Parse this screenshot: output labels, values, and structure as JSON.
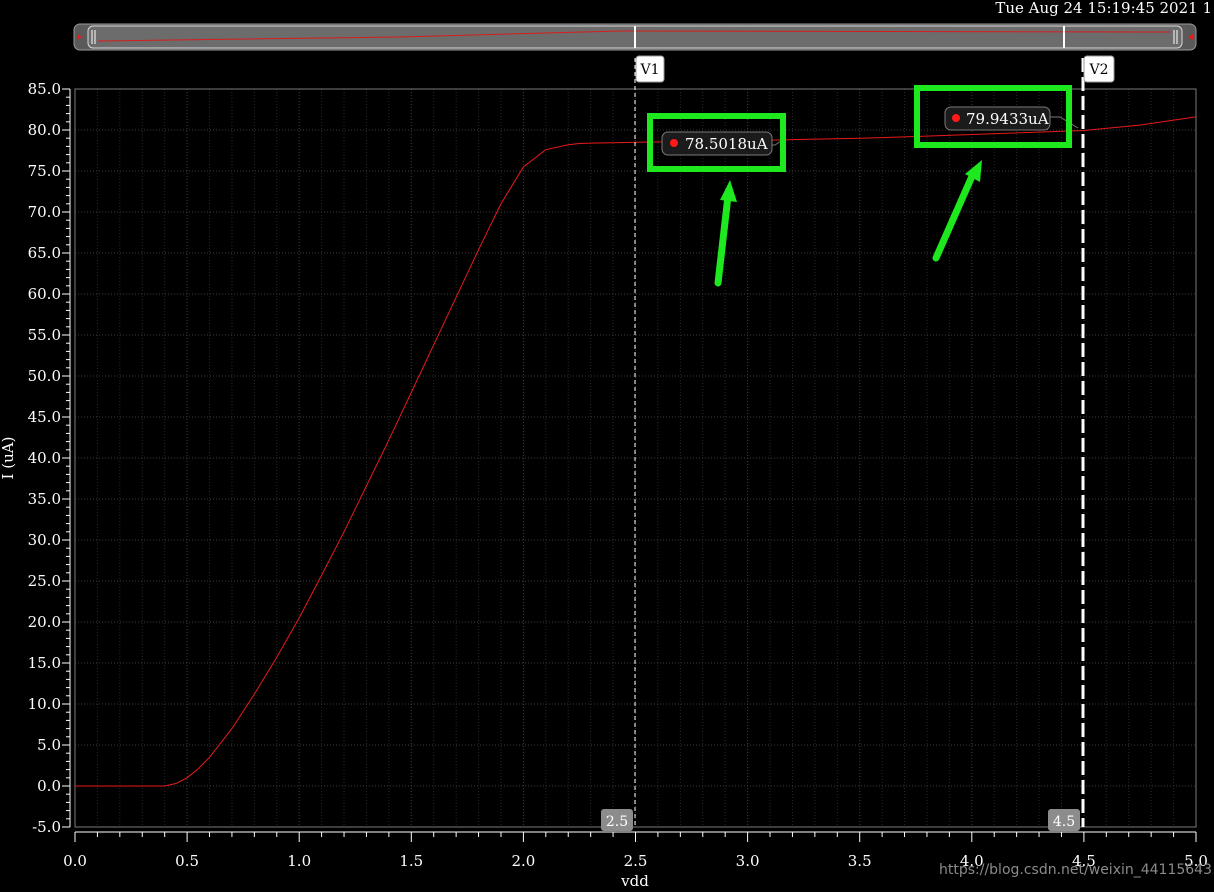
{
  "header": {
    "timestamp": "Tue Aug 24 15:19:45 2021  1"
  },
  "watermark": "https://blog.csdn.net/weixin_44115643",
  "markers": {
    "v1": {
      "label": "V1",
      "x": 2.5,
      "readout": "2.5",
      "point_label": "78.5018uA",
      "y": 78.5018
    },
    "v2": {
      "label": "V2",
      "x": 4.5,
      "readout": "4.5",
      "point_label": "79.9433uA",
      "y": 79.9433
    }
  },
  "colors": {
    "background": "#000000",
    "grid": "#3a3a3a",
    "trace": "#e8191c",
    "axis": "#ffffff",
    "highlight": "#1ee81e",
    "label_bg": "#2b2b2b"
  },
  "chart_data": {
    "type": "line",
    "title": "",
    "xlabel": "vdd",
    "ylabel": "I (uA)",
    "xlim": [
      0.0,
      5.0
    ],
    "ylim": [
      -5.0,
      85.0
    ],
    "grid": true,
    "x_ticks": [
      "0.0",
      "0.5",
      "1.0",
      "1.5",
      "2.0",
      "2.5",
      "3.0",
      "3.5",
      "4.0",
      "4.5",
      "5.0"
    ],
    "y_ticks": [
      "85.0",
      "80.0",
      "75.0",
      "70.0",
      "65.0",
      "60.0",
      "55.0",
      "50.0",
      "45.0",
      "40.0",
      "35.0",
      "30.0",
      "25.0",
      "20.0",
      "15.0",
      "10.0",
      "5.0",
      "0.0",
      "-5.0"
    ],
    "series": [
      {
        "name": "",
        "x": [
          0.0,
          0.4,
          0.45,
          0.5,
          0.55,
          0.6,
          0.7,
          0.8,
          0.9,
          1.0,
          1.1,
          1.2,
          1.3,
          1.4,
          1.5,
          1.6,
          1.7,
          1.8,
          1.9,
          2.0,
          2.1,
          2.2,
          2.25,
          2.3,
          2.4,
          2.5,
          2.75,
          3.0,
          3.25,
          3.5,
          3.75,
          4.0,
          4.25,
          4.5,
          4.75,
          5.0
        ],
        "y": [
          0.0,
          0.0,
          0.3,
          1.0,
          2.1,
          3.5,
          7.0,
          11.2,
          15.7,
          20.5,
          25.7,
          31.0,
          36.6,
          42.2,
          48.0,
          53.8,
          59.6,
          65.4,
          71.0,
          75.5,
          77.6,
          78.2,
          78.35,
          78.4,
          78.45,
          78.5,
          78.6,
          78.7,
          78.85,
          79.0,
          79.2,
          79.45,
          79.7,
          79.94,
          80.6,
          81.6
        ]
      }
    ]
  }
}
